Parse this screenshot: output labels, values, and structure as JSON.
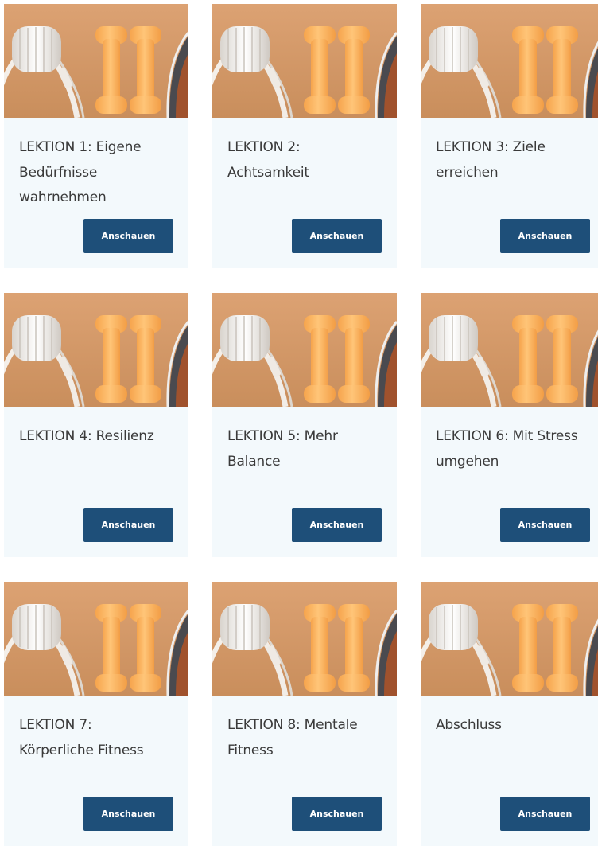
{
  "lessons": [
    {
      "title": "LEKTION 1: Eigene Bedürfnisse wahrnehmen",
      "button": "Anschauen"
    },
    {
      "title": "LEKTION 2: Achtsamkeit",
      "button": "Anschauen"
    },
    {
      "title": "LEKTION 3: Ziele erreichen",
      "button": "Anschauen"
    },
    {
      "title": "LEKTION 4: Resilienz",
      "button": "Anschauen"
    },
    {
      "title": "LEKTION 5: Mehr Balance",
      "button": "Anschauen"
    },
    {
      "title": "LEKTION 6: Mit Stress umgehen",
      "button": "Anschauen"
    },
    {
      "title": "LEKTION 7: Körperliche Fitness",
      "button": "Anschauen"
    },
    {
      "title": "LEKTION 8: Mentale Fitness",
      "button": "Anschauen"
    },
    {
      "title": "Abschluss",
      "button": "Anschauen"
    }
  ],
  "colors": {
    "card_bg": "#f3f9fc",
    "button_bg": "#1e4f79",
    "image_bg": "#d39a68",
    "dumbbell": "#f9b15e"
  }
}
